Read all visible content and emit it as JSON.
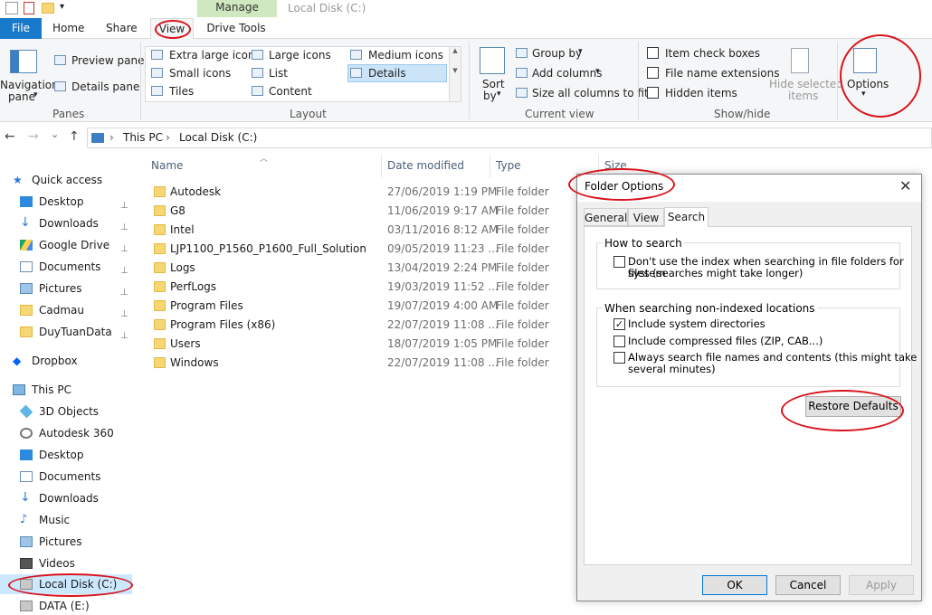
{
  "window": {
    "manage_tab": "Manage",
    "title": "Local Disk (C:)"
  },
  "tabs": {
    "file": "File",
    "home": "Home",
    "share": "Share",
    "view": "View",
    "drive_tools": "Drive Tools"
  },
  "ribbon": {
    "panes": {
      "navigation_pane_1": "Navigation",
      "navigation_pane_2": "pane",
      "preview_pane": "Preview pane",
      "details_pane": "Details pane",
      "group": "Panes"
    },
    "layout": {
      "extra_large_icons": "Extra large icons",
      "large_icons": "Large icons",
      "medium_icons": "Medium icons",
      "small_icons": "Small icons",
      "list": "List",
      "details": "Details",
      "tiles": "Tiles",
      "content": "Content",
      "group": "Layout"
    },
    "current_view": {
      "sort_by_1": "Sort",
      "sort_by_2": "by",
      "group_by": "Group by",
      "add_columns": "Add columns",
      "size_all_columns": "Size all columns to fit",
      "group": "Current view"
    },
    "show_hide": {
      "item_check_boxes": "Item check boxes",
      "file_name_extensions": "File name extensions",
      "hidden_items": "Hidden items",
      "hide_selected_1": "Hide selected",
      "hide_selected_2": "items",
      "group": "Show/hide"
    },
    "options": "Options"
  },
  "address": {
    "this_pc": "This PC",
    "local_disk": "Local Disk (C:)"
  },
  "nav": {
    "quick_access": "Quick access",
    "quick_items": [
      "Desktop",
      "Downloads",
      "Google Drive",
      "Documents",
      "Pictures",
      "Cadmau",
      "DuyTuanData"
    ],
    "dropbox": "Dropbox",
    "this_pc": "This PC",
    "pc_items": [
      "3D Objects",
      "Autodesk 360",
      "Desktop",
      "Documents",
      "Downloads",
      "Music",
      "Pictures",
      "Videos",
      "Local Disk (C:)",
      "DATA (E:)"
    ]
  },
  "columns": {
    "name": "Name",
    "date_modified": "Date modified",
    "type": "Type",
    "size": "Size"
  },
  "files": [
    {
      "name": "Autodesk",
      "date": "27/06/2019 1:19 PM",
      "type": "File folder"
    },
    {
      "name": "G8",
      "date": "11/06/2019 9:17 AM",
      "type": "File folder"
    },
    {
      "name": "Intel",
      "date": "03/11/2016 8:12 AM",
      "type": "File folder"
    },
    {
      "name": "LJP1100_P1560_P1600_Full_Solution",
      "date": "09/05/2019 11:23 ...",
      "type": "File folder"
    },
    {
      "name": "Logs",
      "date": "13/04/2019 2:24 PM",
      "type": "File folder"
    },
    {
      "name": "PerfLogs",
      "date": "19/03/2019 11:52 ...",
      "type": "File folder"
    },
    {
      "name": "Program Files",
      "date": "19/07/2019 4:00 AM",
      "type": "File folder"
    },
    {
      "name": "Program Files (x86)",
      "date": "22/07/2019 11:08 ...",
      "type": "File folder"
    },
    {
      "name": "Users",
      "date": "18/07/2019 1:05 PM",
      "type": "File folder"
    },
    {
      "name": "Windows",
      "date": "22/07/2019 11:08 ...",
      "type": "File folder"
    }
  ],
  "dialog": {
    "title": "Folder Options",
    "tabs": {
      "general": "General",
      "view": "View",
      "search": "Search"
    },
    "how_to_search": "How to search",
    "dont_use_index_1": "Don't use the index when searching in file folders for system",
    "dont_use_index_2": "files (searches might take longer)",
    "non_indexed": "When searching non-indexed locations",
    "include_system": "Include system directories",
    "include_compressed": "Include compressed files (ZIP, CAB...)",
    "always_search_1": "Always search file names and contents (this might take",
    "always_search_2": "several minutes)",
    "restore_defaults": "Restore Defaults",
    "ok": "OK",
    "cancel": "Cancel",
    "apply": "Apply",
    "check_mark": "✓"
  },
  "icons": {
    "back": "←",
    "forward": "→",
    "recent": "⌄",
    "up": "↑",
    "breadcrumb_sep": "›",
    "close": "✕",
    "pin": "📌",
    "dropdown": "▾",
    "scroll_up": "▲",
    "scroll_down": "▼"
  }
}
